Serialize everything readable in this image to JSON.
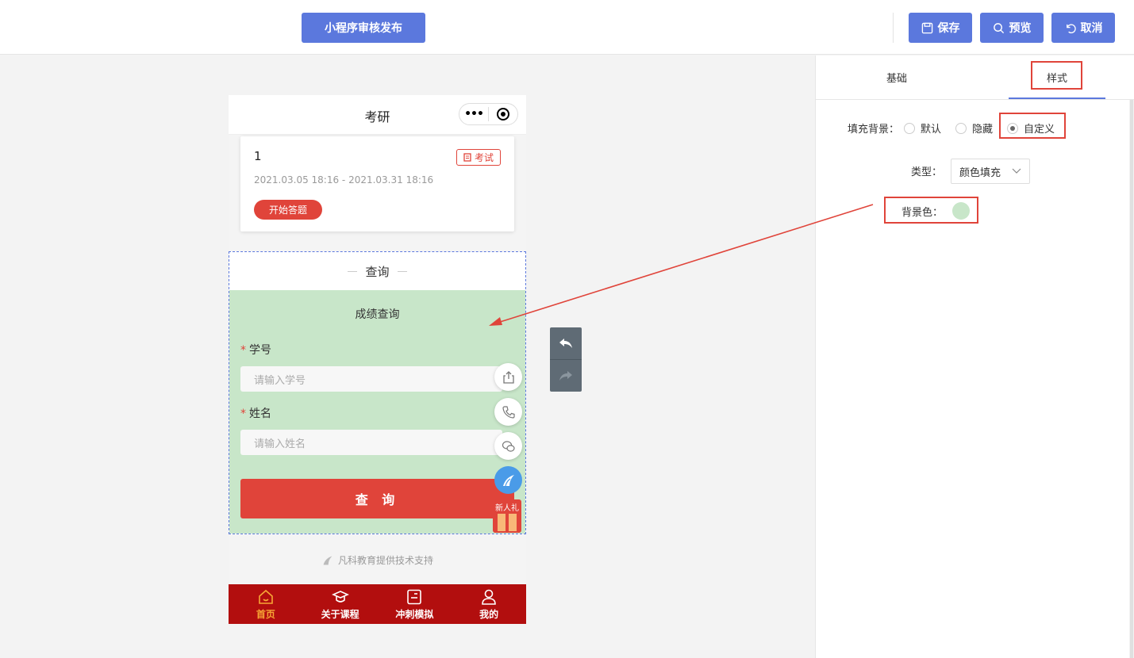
{
  "topbar": {
    "publish_label": "小程序审核发布",
    "save_label": "保存",
    "preview_label": "预览",
    "cancel_label": "取消"
  },
  "phone": {
    "title": "考研",
    "capsule_more": "•••",
    "card": {
      "number": "1",
      "tag": "考试",
      "date_range": "2021.03.05 18:16 - 2021.03.31 18:16",
      "start_button": "开始答题"
    },
    "query_section": {
      "heading": "查询",
      "title": "成绩查询",
      "field1_label": "学号",
      "field1_placeholder": "请输入学号",
      "field2_label": "姓名",
      "field2_placeholder": "请输入姓名",
      "required_mark": "*",
      "submit_label": "查 询",
      "gift_label": "新人礼"
    },
    "support_text": "凡科教育提供技术支持",
    "tabbar": [
      {
        "label": "首页",
        "icon": "home-icon",
        "active": true
      },
      {
        "label": "关于课程",
        "icon": "graduation-cap-icon",
        "active": false
      },
      {
        "label": "冲刺模拟",
        "icon": "notebook-icon",
        "active": false
      },
      {
        "label": "我的",
        "icon": "user-icon",
        "active": false
      }
    ]
  },
  "right_panel": {
    "tab_basic": "基础",
    "tab_style": "样式",
    "fill_bg_label": "填充背景：",
    "fill_options": [
      "默认",
      "隐藏",
      "自定义"
    ],
    "fill_selected": "自定义",
    "type_label": "类型：",
    "type_value": "颜色填充",
    "bg_color_label": "背景色：",
    "bg_color": "#c8e6c9"
  },
  "colors": {
    "accent": "#5b78dd",
    "brand_red": "#e0443a",
    "tabbar_bg": "#b20e0e",
    "query_bg": "#c8e6c9"
  }
}
